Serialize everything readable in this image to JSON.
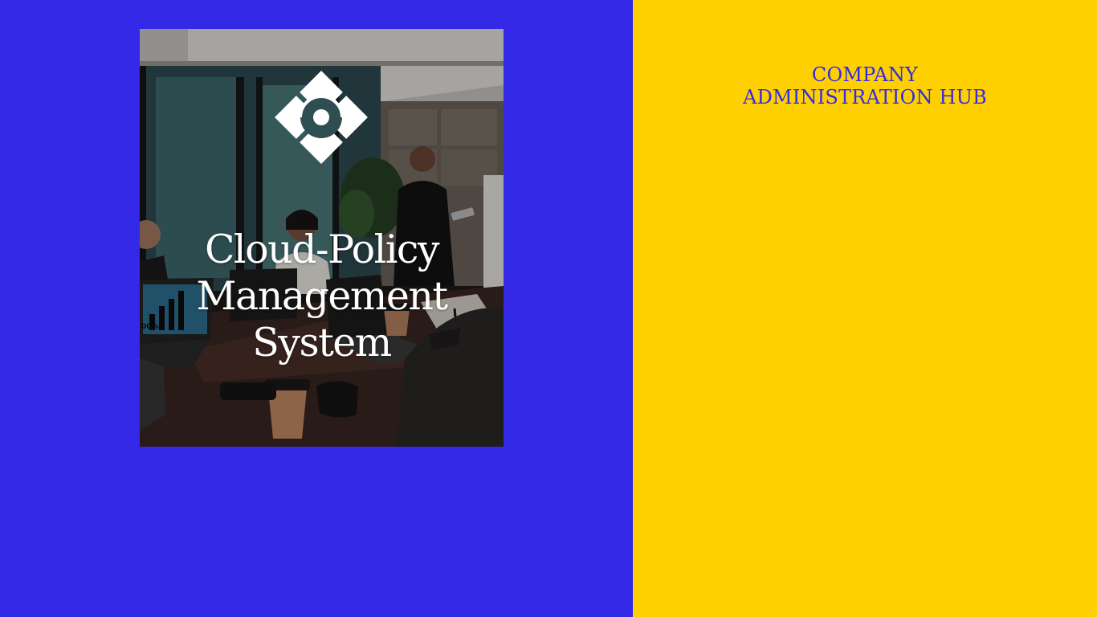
{
  "brand": {
    "primary_color": "#3329e6",
    "secondary_color": "#ffd000",
    "logo_icon": "diamond-quad-logo-icon"
  },
  "hero": {
    "title_lines": [
      "Cloud-Policy",
      "Management",
      "System"
    ],
    "photo_subject": "team-meeting-photo",
    "laptop_screen_text": "00%"
  },
  "sidebar": {
    "heading_lines": [
      "COMPANY",
      "ADMINISTRATION HUB"
    ]
  }
}
